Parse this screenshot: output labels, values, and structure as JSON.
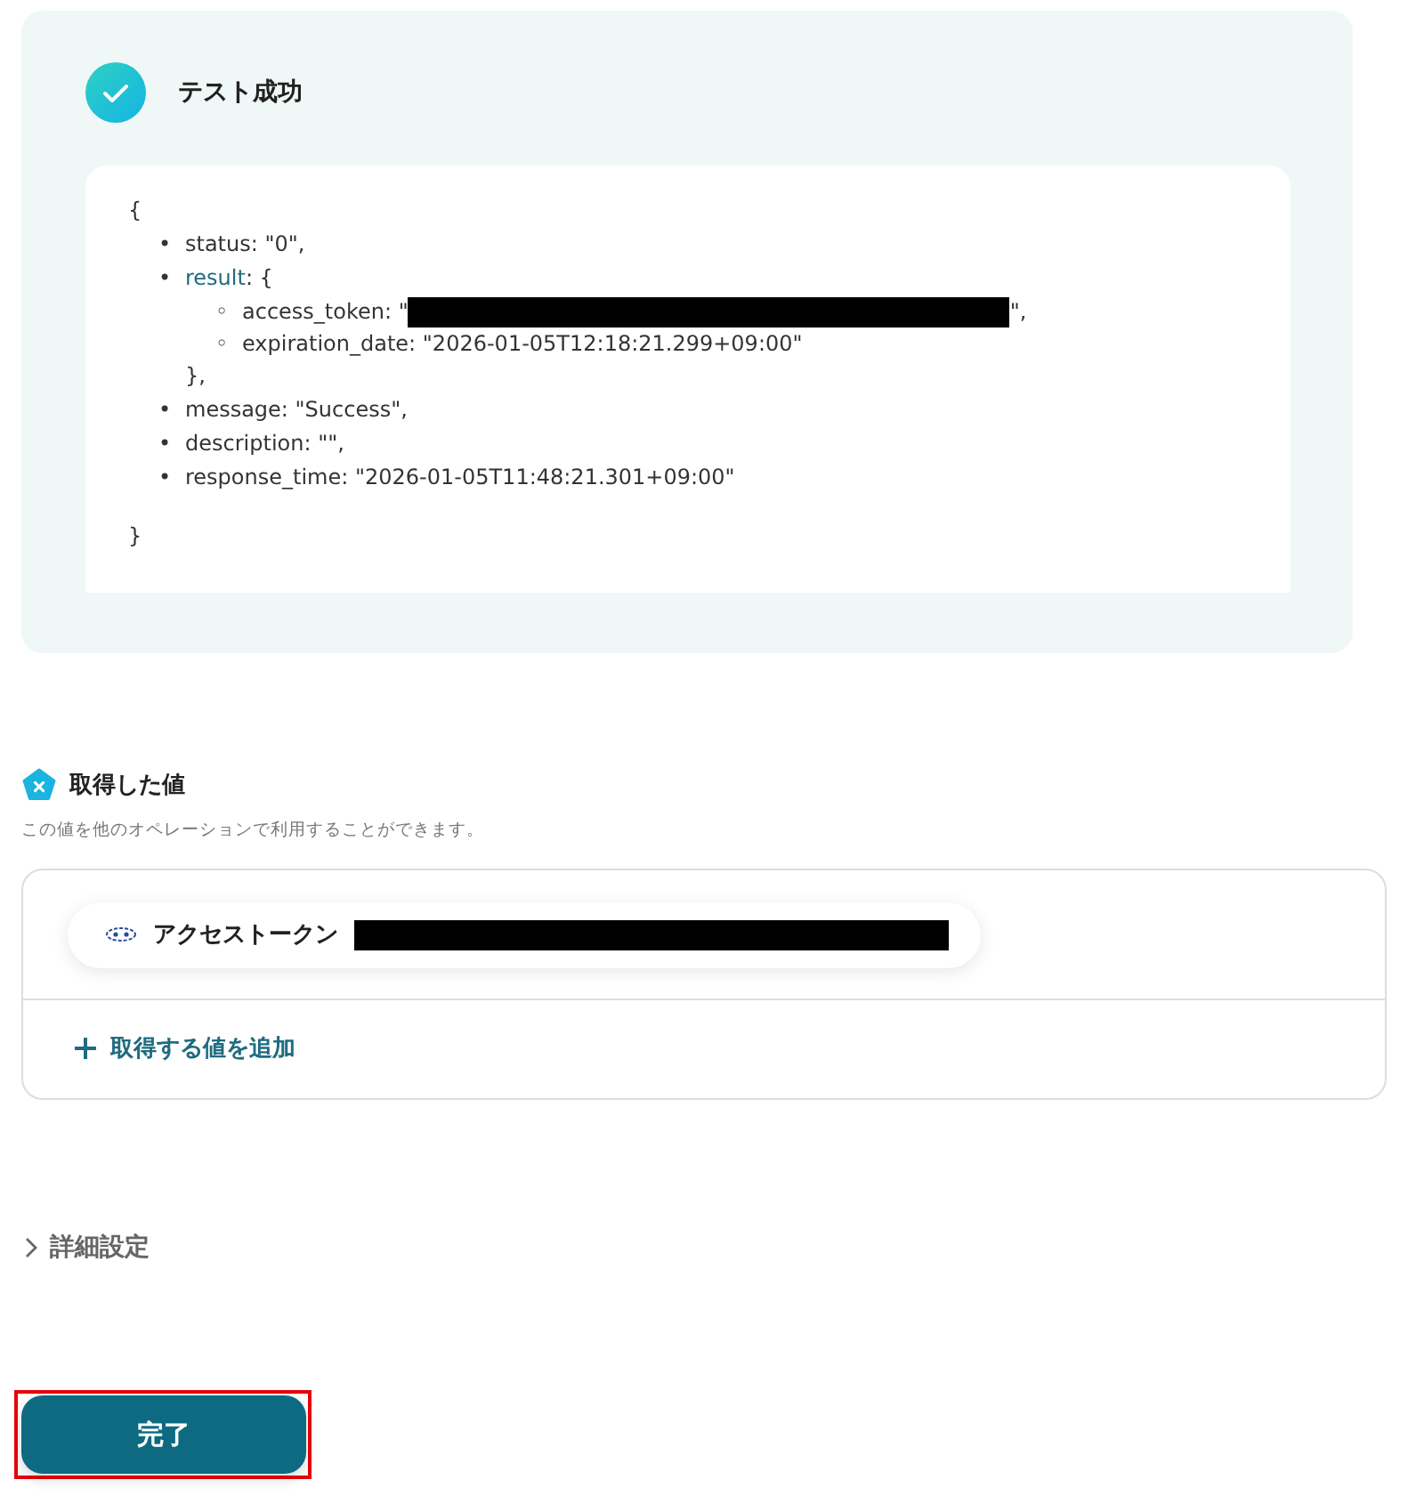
{
  "test_result": {
    "title": "テスト成功",
    "response": {
      "open": "{",
      "close": "}",
      "items": [
        {
          "marker": "•",
          "text": "status: \"0\","
        },
        {
          "marker": "•",
          "key": "result",
          "is_link": true,
          "text": ": {",
          "close": "},",
          "children": [
            {
              "marker": "◦",
              "text": "access_token: \"",
              "redacted": true,
              "after": "\","
            },
            {
              "marker": "◦",
              "text": "expiration_date: \"2026-01-05T12:18:21.299+09:00\""
            }
          ]
        },
        {
          "marker": "•",
          "text": "message: \"Success\","
        },
        {
          "marker": "•",
          "text": "description: \"\","
        },
        {
          "marker": "•",
          "text": "response_time: \"2026-01-05T11:48:21.301+09:00\""
        }
      ]
    }
  },
  "obtained_values": {
    "title": "取得した値",
    "description": "この値を他のオペレーションで利用することができます。",
    "items": [
      {
        "label": "アクセストークン",
        "redacted": true
      }
    ],
    "add_label": "取得する値を追加"
  },
  "advanced_settings": {
    "label": "詳細設定",
    "expanded": false
  },
  "done_button": {
    "label": "完了",
    "highlighted": true
  }
}
